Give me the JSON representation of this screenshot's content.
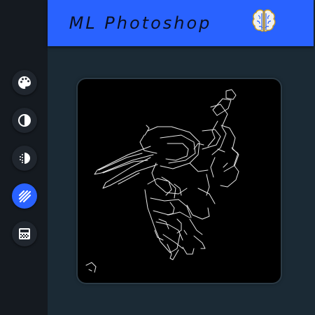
{
  "header": {
    "title": "ML Photoshop",
    "logo_icon": "brain-icon",
    "background": "#2962ff"
  },
  "sidebar": {
    "tools": [
      {
        "id": "color",
        "icon": "palette-icon",
        "active": false
      },
      {
        "id": "contrast",
        "icon": "contrast-icon",
        "active": false
      },
      {
        "id": "halftone",
        "icon": "halftone-icon",
        "active": false
      },
      {
        "id": "edges",
        "icon": "hatch-icon",
        "active": true
      },
      {
        "id": "pixelate",
        "icon": "grid-icon",
        "active": false
      }
    ],
    "accent": "#2962ff"
  },
  "canvas": {
    "image": "edge-detected-spaceship",
    "filter": "edge-detection",
    "background": "#000000"
  }
}
